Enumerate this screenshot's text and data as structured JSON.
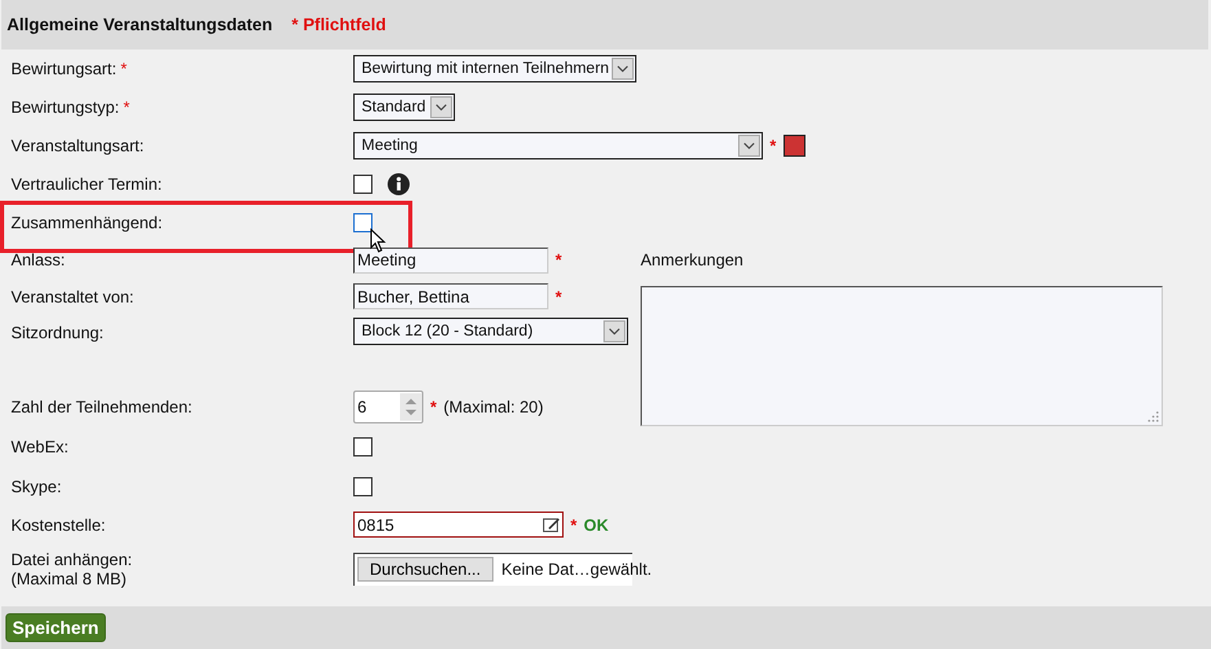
{
  "header": {
    "title": "Allgemeine Veranstaltungsdaten",
    "required_note": "* Pflichtfeld"
  },
  "fields": [
    {
      "kind": "select",
      "label": "Bewirtungsart:",
      "label_marker": "*",
      "value": "Bewirtung mit internen Teilnehmern"
    },
    {
      "kind": "select",
      "label": "Bewirtungstyp:",
      "label_marker": "*",
      "value": "Standard"
    },
    {
      "kind": "select",
      "label": "Veranstaltungsart:",
      "value": "Meeting",
      "marker": "*",
      "color": "#cc3333"
    },
    {
      "kind": "checkbox",
      "label": "Vertraulicher Termin:",
      "checked": false,
      "info": true
    },
    {
      "kind": "checkbox",
      "label": "Zusammenhängend:",
      "checked": false,
      "highlighted": true,
      "focused": true
    },
    {
      "kind": "text",
      "label": "Anlass:",
      "value": "Meeting",
      "marker": "*"
    },
    {
      "kind": "text",
      "label": "Veranstaltet von:",
      "value": "Bucher, Bettina",
      "marker": "*"
    },
    {
      "kind": "select",
      "label": "Sitzordnung:",
      "value": "Block 12 (20 - Standard)"
    },
    {
      "kind": "number",
      "label": "Zahl der Teilnehmenden:",
      "value": "6",
      "marker": "*",
      "note": "(Maximal: 20)"
    },
    {
      "kind": "checkbox",
      "label": "WebEx:",
      "checked": false
    },
    {
      "kind": "checkbox",
      "label": "Skype:",
      "checked": false
    },
    {
      "kind": "text",
      "label": "Kostenstelle:",
      "value": "0815",
      "marker": "*",
      "status": "OK",
      "editable_icon": true
    },
    {
      "kind": "file",
      "label": "Datei anhängen:",
      "sublabel": "(Maximal 8 MB)",
      "button": "Durchsuchen...",
      "value": "Keine Dat…gewählt."
    }
  ],
  "remarks": {
    "label": "Anmerkungen"
  },
  "footer": {
    "save": "Speichern"
  }
}
